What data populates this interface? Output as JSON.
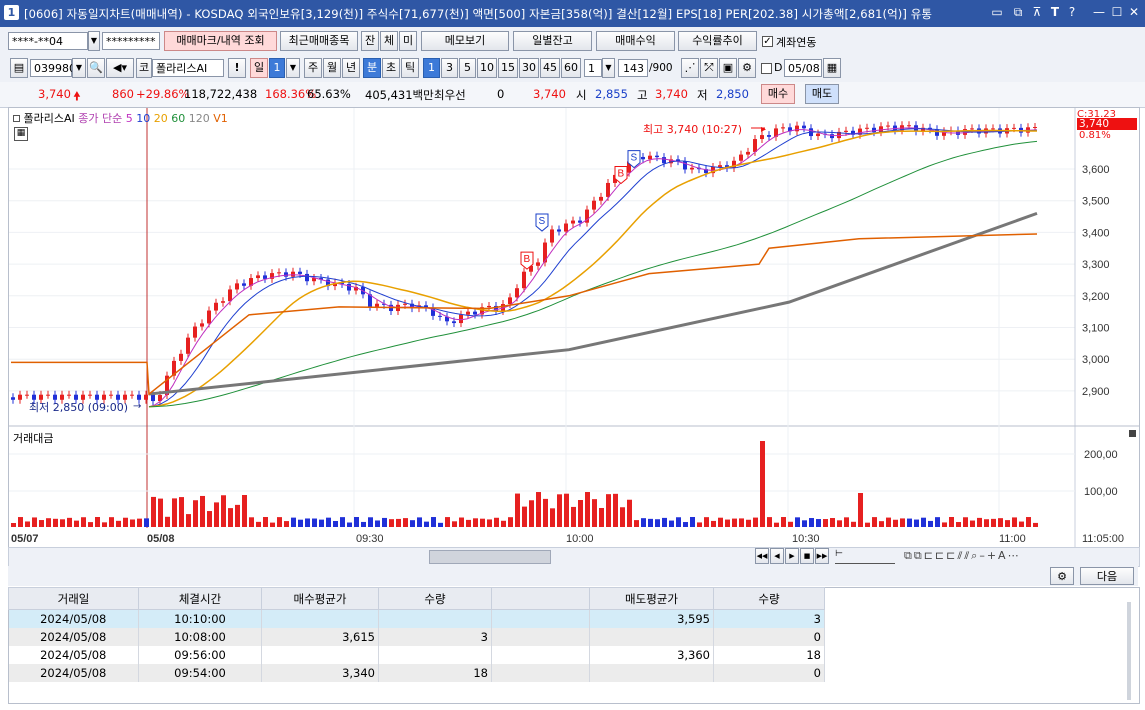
{
  "window": {
    "num_badge": "1",
    "title": "[0606] 자동일지차트(매매내역) - KOSDAQ 외국인보유[3,129(천)] 주식수[71,677(천)] 액면[500] 자본금[358(억)] 결산[12월] EPS[18] PER[202.38] 시가총액[2,681(억)] 유통",
    "icons": [
      "layout-icon",
      "restore-icon",
      "pin-icon",
      "font-icon",
      "help-icon",
      "minimize-icon",
      "maximize-icon",
      "close-icon"
    ]
  },
  "row1": {
    "account": "****-**04",
    "password": "*********",
    "trade_mark_btn": "매매마크/내역 조회",
    "recent_btn": "최근매매종목",
    "jan_btn": "잔",
    "che_btn": "체",
    "mi_btn": "미",
    "memo_btn": "메모보기",
    "daily_balance_btn": "일별잔고",
    "trade_profit_btn": "매매수익",
    "return_trend_btn": "수익률추이",
    "account_link_label": "계좌연동",
    "account_link_checked": true
  },
  "row2": {
    "code": "039980",
    "market": "코",
    "stock_name": "폴라리스AI",
    "period_tabs": [
      "일",
      "1"
    ],
    "periods": [
      "주",
      "월",
      "년",
      "분",
      "초",
      "틱"
    ],
    "intervals": [
      "1",
      "3",
      "5",
      "10",
      "15",
      "30",
      "45",
      "60"
    ],
    "interval_select": "1",
    "count": "143",
    "count_total": "/900",
    "d_label": "D",
    "date": "05/08"
  },
  "row3": {
    "price": "3,740",
    "change": "860",
    "change_rate": "+29.86%",
    "volume": "118,722,438",
    "vol_rate": "168.36%",
    "ratio": "65.63%",
    "amount": "405,431백만",
    "best_label": "최우선",
    "best_value": "0",
    "best_price": "3,740",
    "open_label": "시",
    "open": "2,855",
    "high_label": "고",
    "high": "3,740",
    "low_label": "저",
    "low": "2,850",
    "buy_btn": "매수",
    "sell_btn": "매도"
  },
  "chart_legend": {
    "name": "폴라리스AI",
    "label": "종가 단순",
    "ma": [
      "5",
      "10",
      "20",
      "60",
      "120"
    ],
    "v1": "V1",
    "max_label": "최고 3,740 (10:27)",
    "min_label": "최저 2,850 (09:00)",
    "right_tag_top": "C:31.23",
    "right_tag_price": "3,740",
    "right_tag_pct": "0.81%",
    "sub_title": "거래대금"
  },
  "chart_data": {
    "type": "candlestick",
    "price_axis": [
      "3,600",
      "3,500",
      "3,400",
      "3,300",
      "3,200",
      "3,100",
      "3,000",
      "2,900"
    ],
    "volume_axis": [
      "200,00",
      "100,00"
    ],
    "time_axis": [
      "05/07",
      "05/08",
      "09:30",
      "10:00",
      "10:30",
      "11:00",
      "11:05:00"
    ],
    "markers": [
      "B",
      "S",
      "B",
      "S"
    ]
  },
  "nav": {
    "buttons": [
      "◀◀",
      "◀",
      "▶",
      "■",
      "▶▶"
    ]
  },
  "table_toolbar": {
    "next_btn": "다음"
  },
  "table": {
    "headers": [
      "거래일",
      "체결시간",
      "매수평균가",
      "수량",
      "",
      "매도평균가",
      "수량"
    ],
    "rows": [
      [
        "2024/05/08",
        "10:10:00",
        "",
        "",
        "",
        "3,595",
        "3"
      ],
      [
        "2024/05/08",
        "10:08:00",
        "3,615",
        "3",
        "",
        "",
        "0"
      ],
      [
        "2024/05/08",
        "09:56:00",
        "",
        "",
        "",
        "3,360",
        "18"
      ],
      [
        "2024/05/08",
        "09:54:00",
        "3,340",
        "18",
        "",
        "",
        "0"
      ]
    ]
  }
}
